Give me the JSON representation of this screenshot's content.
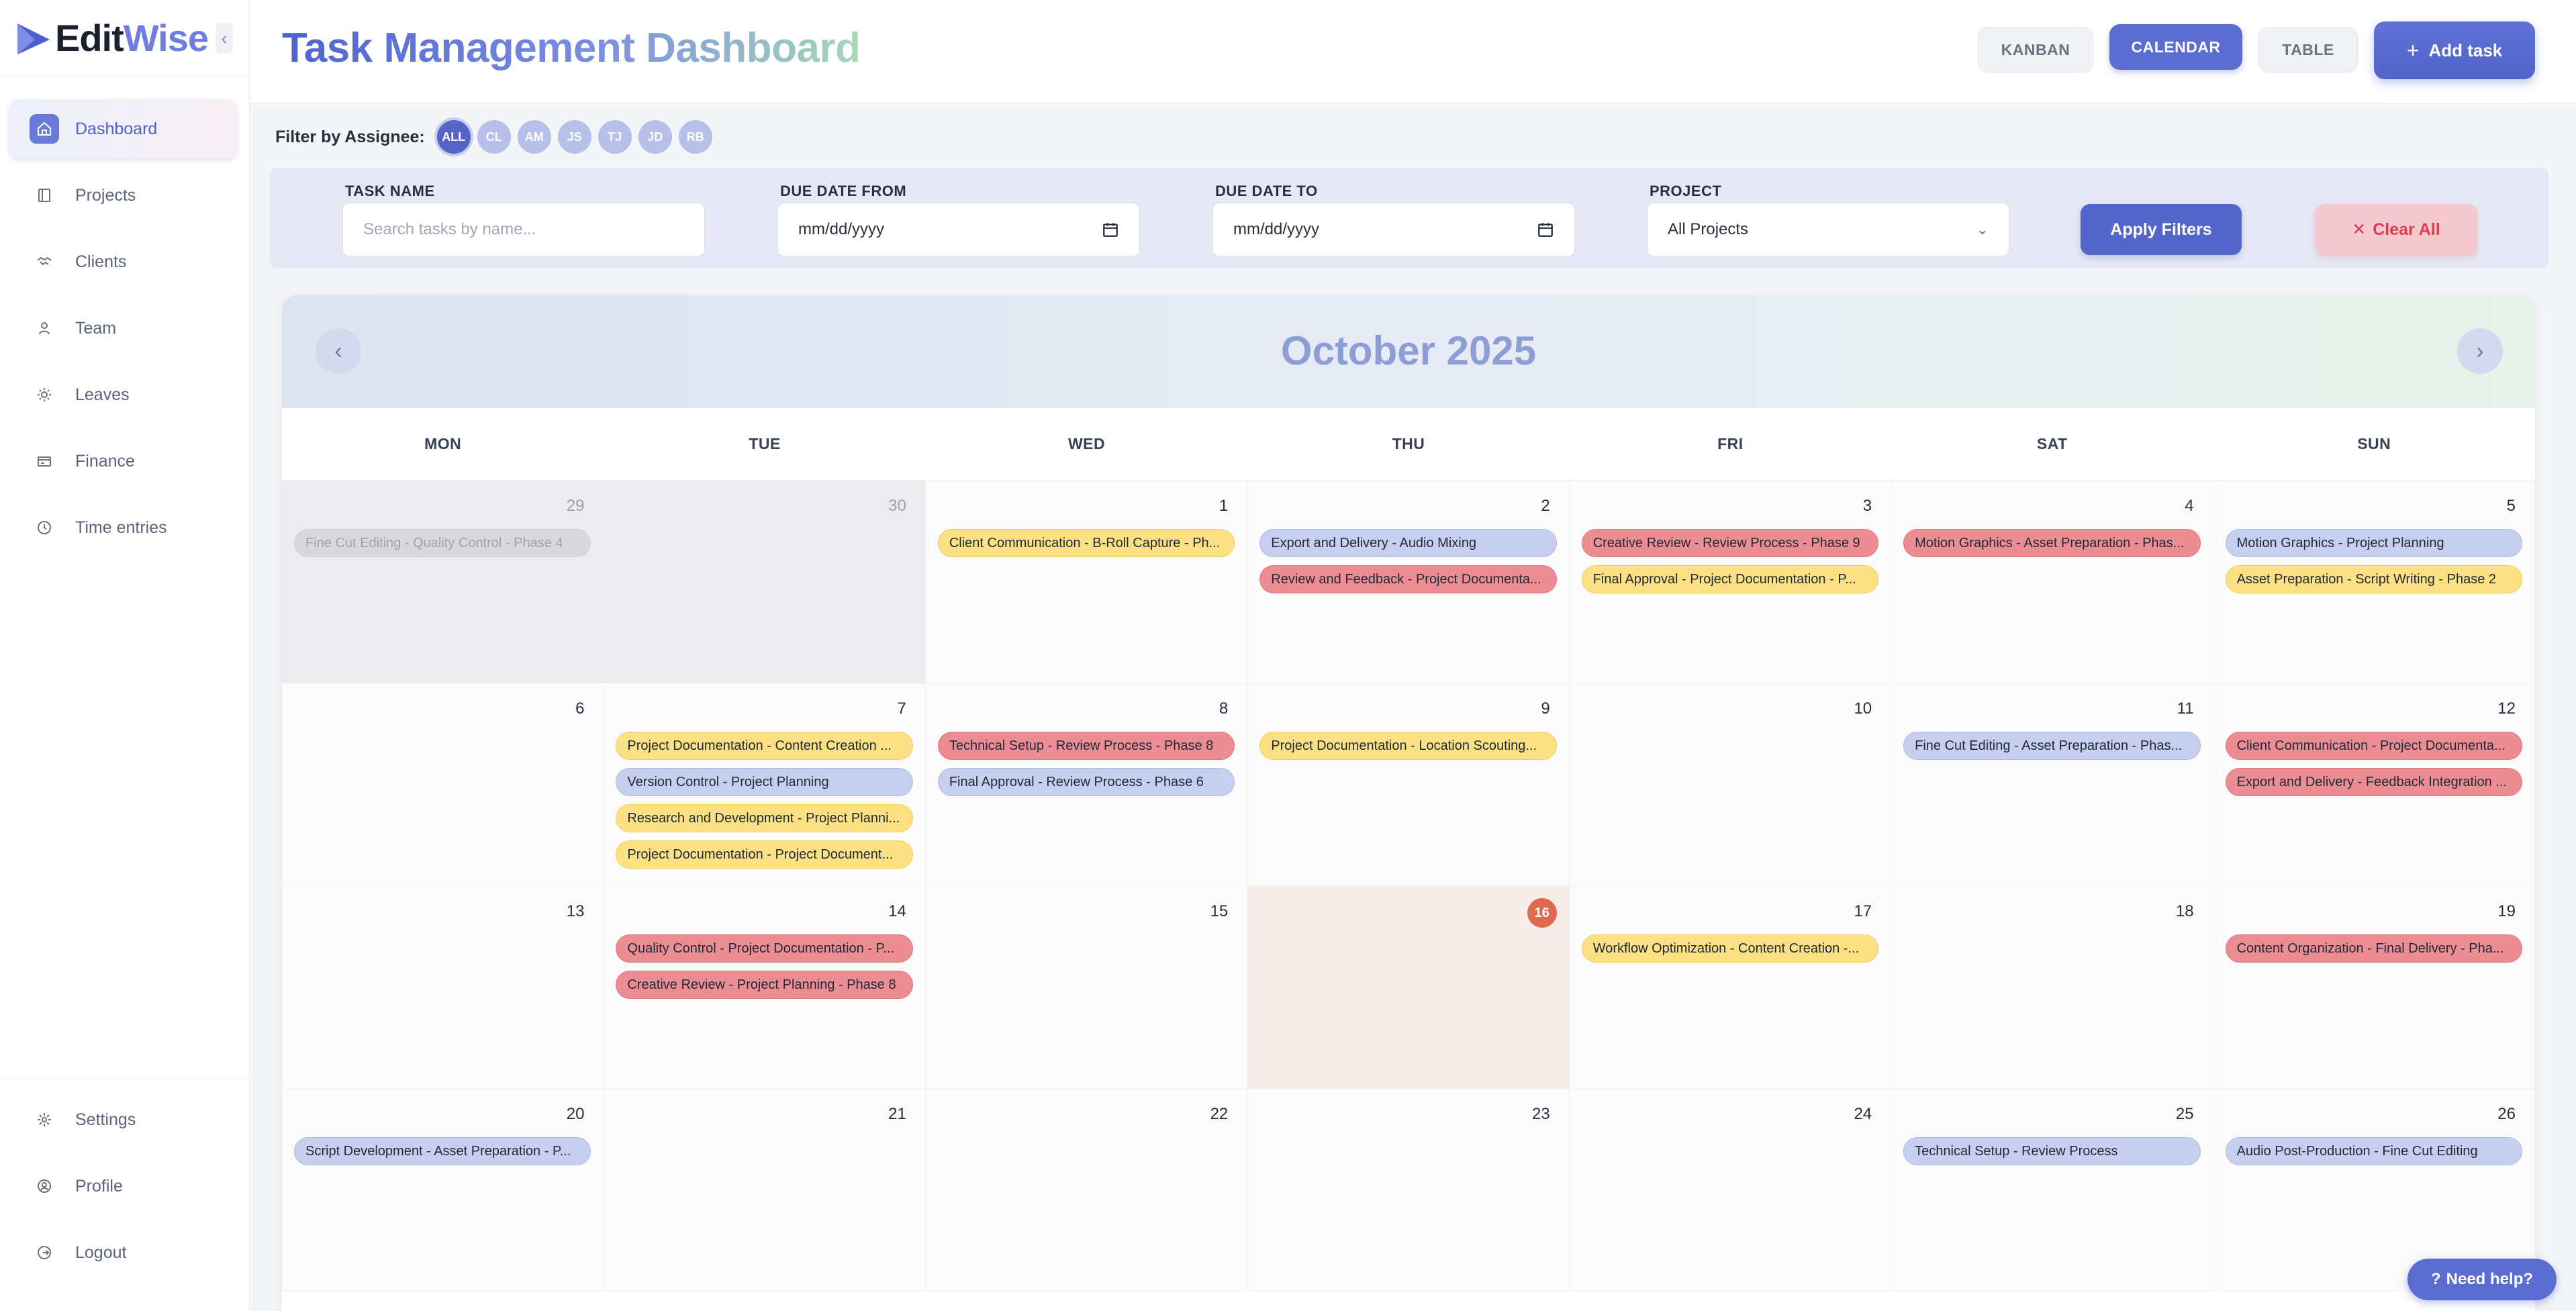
{
  "brand": {
    "name_part1": "Edit",
    "name_part2": "Wise",
    "collapse_icon": "chevron-left-icon"
  },
  "sidebar": {
    "items": [
      {
        "label": "Dashboard",
        "icon": "home-icon",
        "active": true
      },
      {
        "label": "Projects",
        "icon": "folder-icon"
      },
      {
        "label": "Clients",
        "icon": "handshake-icon"
      },
      {
        "label": "Team",
        "icon": "user-icon"
      },
      {
        "label": "Leaves",
        "icon": "sun-icon"
      },
      {
        "label": "Finance",
        "icon": "wallet-icon"
      },
      {
        "label": "Time entries",
        "icon": "clock-icon"
      }
    ],
    "bottom": [
      {
        "label": "Settings",
        "icon": "gear-icon"
      },
      {
        "label": "Profile",
        "icon": "profile-icon"
      },
      {
        "label": "Logout",
        "icon": "logout-icon"
      }
    ]
  },
  "header": {
    "title": "Task Management Dashboard",
    "views": [
      "KANBAN",
      "CALENDAR",
      "TABLE"
    ],
    "active_view": "CALENDAR",
    "add_task": "Add task"
  },
  "assignee_filter": {
    "label": "Filter by Assignee:",
    "chips": [
      "ALL",
      "CL",
      "AM",
      "JS",
      "TJ",
      "JD",
      "RB"
    ]
  },
  "filters": {
    "task_name_label": "TASK NAME",
    "task_name_placeholder": "Search tasks by name...",
    "due_from_label": "DUE DATE FROM",
    "due_from_value": "mm/dd/yyyy",
    "due_to_label": "DUE DATE TO",
    "due_to_value": "mm/dd/yyyy",
    "project_label": "PROJECT",
    "project_value": "All Projects",
    "apply": "Apply Filters",
    "clear": "Clear All"
  },
  "calendar": {
    "month_title": "October 2025",
    "weekdays": [
      "MON",
      "TUE",
      "WED",
      "THU",
      "FRI",
      "SAT",
      "SUN"
    ],
    "days": [
      {
        "num": "29",
        "other": true,
        "tasks": [
          {
            "text": "Fine Cut Editing - Quality Control - Phase 4",
            "color": "grey"
          }
        ]
      },
      {
        "num": "30",
        "other": true,
        "tasks": []
      },
      {
        "num": "1",
        "tasks": [
          {
            "text": "Client Communication - B-Roll Capture - Ph...",
            "color": "yellow"
          }
        ]
      },
      {
        "num": "2",
        "tasks": [
          {
            "text": "Export and Delivery - Audio Mixing",
            "color": "blue"
          },
          {
            "text": "Review and Feedback - Project Documenta...",
            "color": "red"
          }
        ]
      },
      {
        "num": "3",
        "tasks": [
          {
            "text": "Creative Review - Review Process - Phase 9",
            "color": "red"
          },
          {
            "text": "Final Approval - Project Documentation - P...",
            "color": "yellow"
          }
        ]
      },
      {
        "num": "4",
        "tasks": [
          {
            "text": "Motion Graphics - Asset Preparation - Phas...",
            "color": "red"
          }
        ]
      },
      {
        "num": "5",
        "tasks": [
          {
            "text": "Motion Graphics - Project Planning",
            "color": "blue"
          },
          {
            "text": "Asset Preparation - Script Writing - Phase 2",
            "color": "yellow"
          }
        ]
      },
      {
        "num": "6",
        "tasks": []
      },
      {
        "num": "7",
        "tasks": [
          {
            "text": "Project Documentation - Content Creation ...",
            "color": "yellow"
          },
          {
            "text": "Version Control - Project Planning",
            "color": "blue"
          },
          {
            "text": "Research and Development - Project Planni...",
            "color": "yellow"
          },
          {
            "text": "Project Documentation - Project Document...",
            "color": "yellow"
          }
        ]
      },
      {
        "num": "8",
        "tasks": [
          {
            "text": "Technical Setup - Review Process - Phase 8",
            "color": "red"
          },
          {
            "text": "Final Approval - Review Process - Phase 6",
            "color": "blue"
          }
        ]
      },
      {
        "num": "9",
        "tasks": [
          {
            "text": "Project Documentation - Location Scouting...",
            "color": "yellow"
          }
        ]
      },
      {
        "num": "10",
        "tasks": []
      },
      {
        "num": "11",
        "tasks": [
          {
            "text": "Fine Cut Editing - Asset Preparation - Phas...",
            "color": "blue"
          }
        ]
      },
      {
        "num": "12",
        "tasks": [
          {
            "text": "Client Communication - Project Documenta...",
            "color": "red"
          },
          {
            "text": "Export and Delivery - Feedback Integration ...",
            "color": "red"
          }
        ]
      },
      {
        "num": "13",
        "tasks": []
      },
      {
        "num": "14",
        "tasks": [
          {
            "text": "Quality Control - Project Documentation - P...",
            "color": "red"
          },
          {
            "text": "Creative Review - Project Planning - Phase 8",
            "color": "red"
          }
        ]
      },
      {
        "num": "15",
        "tasks": []
      },
      {
        "num": "16",
        "today": true,
        "tasks": []
      },
      {
        "num": "17",
        "tasks": [
          {
            "text": "Workflow Optimization - Content Creation -...",
            "color": "yellow"
          }
        ]
      },
      {
        "num": "18",
        "tasks": []
      },
      {
        "num": "19",
        "tasks": [
          {
            "text": "Content Organization - Final Delivery - Pha...",
            "color": "red"
          }
        ]
      },
      {
        "num": "20",
        "tasks": [
          {
            "text": "Script Development - Asset Preparation - P...",
            "color": "blue"
          }
        ]
      },
      {
        "num": "21",
        "tasks": []
      },
      {
        "num": "22",
        "tasks": []
      },
      {
        "num": "23",
        "tasks": []
      },
      {
        "num": "24",
        "tasks": []
      },
      {
        "num": "25",
        "tasks": [
          {
            "text": "Technical Setup - Review Process",
            "color": "blue"
          }
        ]
      },
      {
        "num": "26",
        "tasks": [
          {
            "text": "Audio Post-Production - Fine Cut Editing",
            "color": "blue"
          }
        ]
      }
    ]
  },
  "help": {
    "label": "Need help?",
    "icon": "question-icon"
  },
  "colors": {
    "accent": "#5b6dd0",
    "task_yellow": "#fbe084",
    "task_blue": "#c7cfee",
    "task_red": "#ec8d94",
    "today": "#e06a4f"
  }
}
